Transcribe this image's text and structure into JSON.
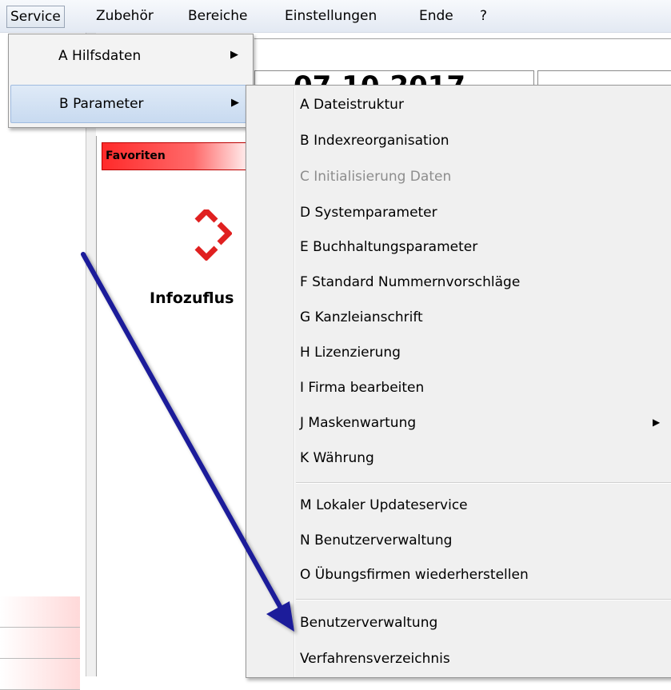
{
  "menubar": {
    "items": [
      "Service",
      "Zubehör",
      "Bereiche",
      "Einstellungen",
      "Ende",
      "?"
    ]
  },
  "service_menu": {
    "items": [
      {
        "label": "A  Hilfsdaten",
        "submenu_arrow": "▶"
      },
      {
        "label": "B  Parameter",
        "submenu_arrow": "▶"
      }
    ]
  },
  "parameter_menu": {
    "items": [
      {
        "label": "A  Dateistruktur",
        "enabled": true
      },
      {
        "label": "B  Indexreorganisation",
        "enabled": true
      },
      {
        "label": "C  Initialisierung Daten",
        "enabled": false
      },
      {
        "label": "D  Systemparameter",
        "enabled": true
      },
      {
        "label": "E  Buchhaltungsparameter",
        "enabled": true
      },
      {
        "label": "F  Standard Nummernvorschläge",
        "enabled": true
      },
      {
        "label": "G  Kanzleianschrift",
        "enabled": true
      },
      {
        "label": "H  Lizenzierung",
        "enabled": true
      },
      {
        "label": "I  Firma bearbeiten",
        "enabled": true
      },
      {
        "label": "J  Maskenwartung",
        "enabled": true,
        "submenu_arrow": "▶"
      },
      {
        "label": "K  Währung",
        "enabled": true
      },
      {
        "label": "M  Lokaler Updateservice",
        "enabled": true
      },
      {
        "label": "N  Benutzerverwaltung",
        "enabled": true
      },
      {
        "label": "O  Übungsfirmen wiederherstellen",
        "enabled": true
      },
      {
        "label": "Benutzerverwaltung",
        "enabled": true
      },
      {
        "label": "Verfahrensverzeichnis",
        "enabled": true
      }
    ]
  },
  "background": {
    "favoriten_label": "Favoriten",
    "widget_label": "Infozuflus",
    "clock_text": "07.10.2017"
  },
  "colors": {
    "favoriten_header": "#ff2a2a",
    "logo_red": "#e02020",
    "annotation_arrow": "#1a1a9a",
    "highlight": "#c8daf0"
  },
  "icons": {
    "logo": "red-diamond-logo-icon",
    "annotation": "pointer-arrow-annotation"
  }
}
